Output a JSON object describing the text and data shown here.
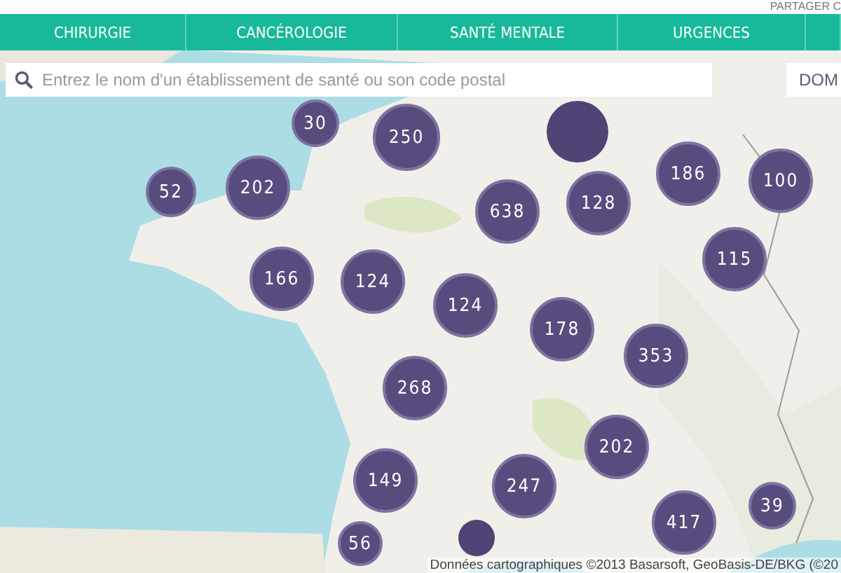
{
  "share_link": "PARTAGER C",
  "tabs": [
    {
      "label": "CHIRURGIE",
      "selected": false
    },
    {
      "label": "CANCÉROLOGIE",
      "selected": false
    },
    {
      "label": "SANTÉ MENTALE",
      "selected": false
    },
    {
      "label": "URGENCES",
      "selected": false
    },
    {
      "selected": false
    }
  ],
  "search": {
    "placeholder": "Entrez le nom d'un établissement de santé ou son code postal"
  },
  "side_button": "DOM",
  "clusters": [
    {
      "kind": "plain"
    },
    {
      "count": "30"
    },
    {
      "count": "250"
    },
    {
      "count": "52"
    },
    {
      "count": "202"
    },
    {
      "count": "638"
    },
    {
      "count": "128"
    },
    {
      "count": "186"
    },
    {
      "count": "100"
    },
    {
      "count": "166"
    },
    {
      "count": "124"
    },
    {
      "count": "124"
    },
    {
      "count": "178"
    },
    {
      "count": "115"
    },
    {
      "count": "353"
    },
    {
      "count": "268"
    },
    {
      "count": "202"
    },
    {
      "count": "149"
    },
    {
      "count": "247"
    },
    {
      "count": "417"
    },
    {
      "count": "39"
    },
    {
      "count": "56"
    },
    {
      "kind": "plain"
    }
  ],
  "attribution": "Données cartographiques ©2013 Basarsoft, GeoBasis-DE/BKG (©20"
}
